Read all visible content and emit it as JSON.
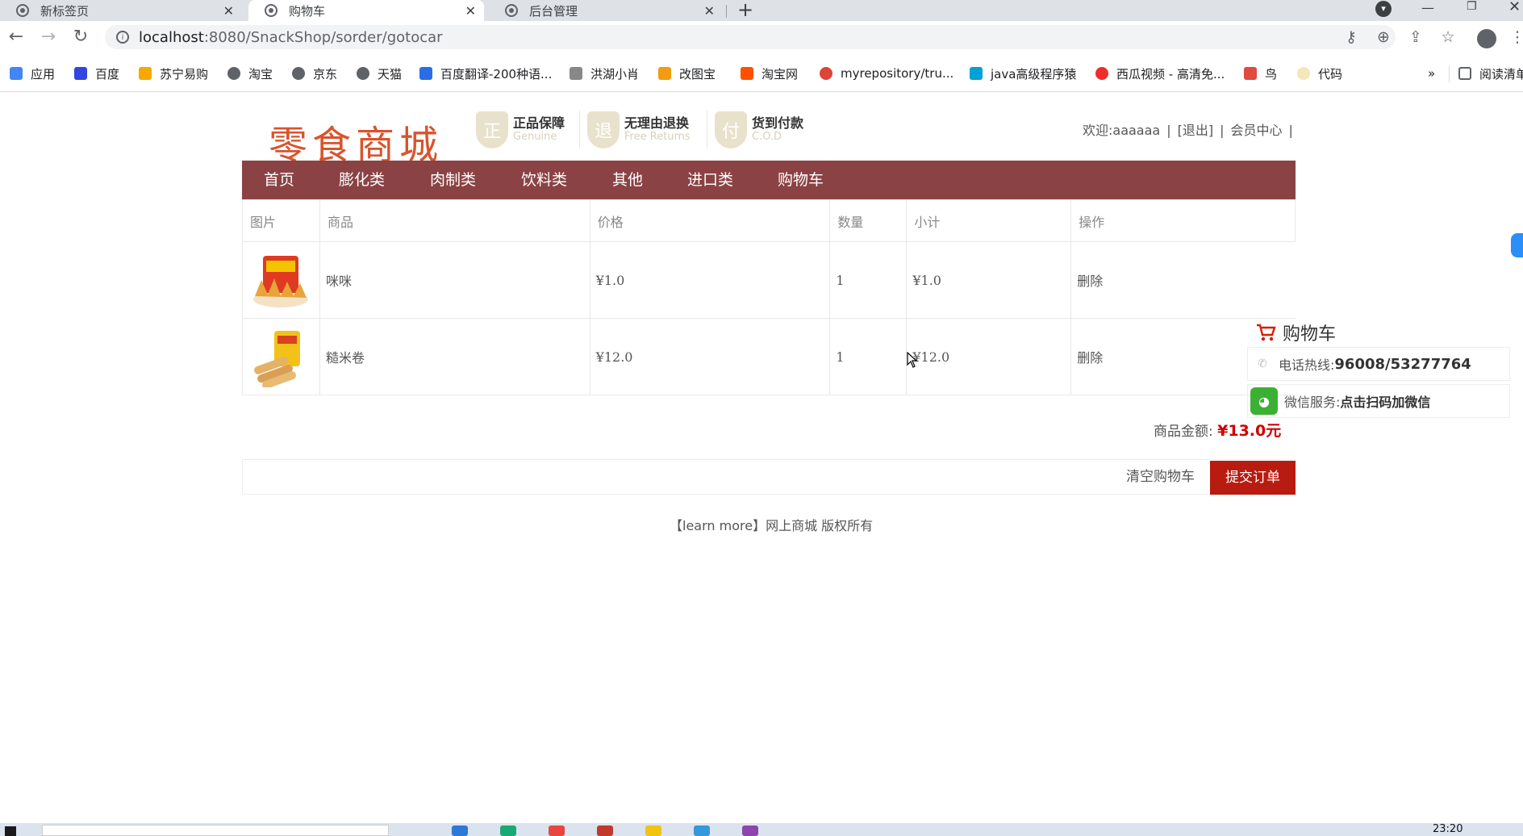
{
  "browser": {
    "tabs": [
      {
        "title": "新标签页",
        "active": false
      },
      {
        "title": "购物车",
        "active": true
      },
      {
        "title": "后台管理",
        "active": false
      }
    ],
    "new_tab": "+",
    "url_host": "localhost",
    "url_path": ":8080/SnackShop/sorder/gotocar",
    "bookmarks": [
      "应用",
      "百度",
      "苏宁易购",
      "淘宝",
      "京东",
      "天猫",
      "百度翻译-200种语...",
      "洪湖小肖",
      "改图宝",
      "淘宝网",
      "myrepository/tru...",
      "java高级程序猿",
      "西瓜视频 - 高清免...",
      "鸟",
      "代码",
      "»",
      "阅读清单"
    ]
  },
  "site": {
    "logo": "零食商城",
    "badges": [
      {
        "glyph": "正",
        "title": "正品保障",
        "sub": "Genuine"
      },
      {
        "glyph": "退",
        "title": "无理由退换",
        "sub": "Free Returns"
      },
      {
        "glyph": "付",
        "title": "货到付款",
        "sub": "C.O.D"
      }
    ],
    "welcome": "欢迎:aaaaaa",
    "sep": "|",
    "logout": "[退出]",
    "member": "会员中心",
    "nav": [
      "首页",
      "膨化类",
      "肉制类",
      "饮料类",
      "其他",
      "进口类",
      "购物车"
    ]
  },
  "cart": {
    "headers": [
      "图片",
      "商品",
      "价格",
      "数量",
      "小计",
      "操作"
    ],
    "rows": [
      {
        "name": "咪咪",
        "price": "¥1.0",
        "qty": "1",
        "subtotal": "¥1.0",
        "action": "删除"
      },
      {
        "name": "糙米卷",
        "price": "¥12.0",
        "qty": "1",
        "subtotal": "¥12.0",
        "action": "删除"
      }
    ],
    "total_label": "商品金额: ",
    "total_value": "¥13.0元",
    "clear": "清空购物车",
    "submit": "提交订单"
  },
  "footer": "【learn more】网上商城 版权所有",
  "side": {
    "title": "购物车",
    "hotline_label": "电话热线: ",
    "hotline": "96008/53277764",
    "wechat_label": "微信服务: ",
    "wechat": "点击扫码加微信"
  },
  "taskbar": {
    "time": "23:20"
  },
  "colors": {
    "nav": "#8b4244",
    "submit": "#b81b0f",
    "price": "#d10000",
    "logo": "#d9532c"
  }
}
